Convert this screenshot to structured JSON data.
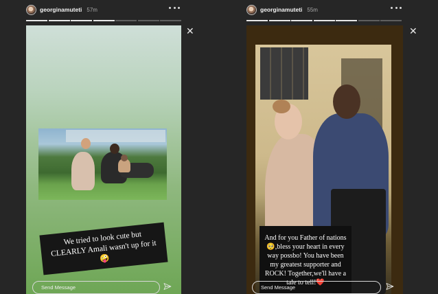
{
  "stories": {
    "left": {
      "username": "georginamuteti",
      "time": "57m",
      "caption": "We tried to look cute but CLEARLY Amali wasn't up for it🤪",
      "send_placeholder": "Send Message"
    },
    "right": {
      "username": "georginamuteti",
      "time": "55m",
      "caption": "And for you Father of nations🥺,bless your heart in every way possbo! You have been my greatest supporter and ROCK! Together,we'll have a tale to tell!❤️",
      "send_placeholder": "Send Message"
    }
  },
  "icons": {
    "more": "more-horizontal-icon",
    "close": "close-icon",
    "send": "send-icon"
  },
  "glyphs": {
    "close": "✕"
  }
}
